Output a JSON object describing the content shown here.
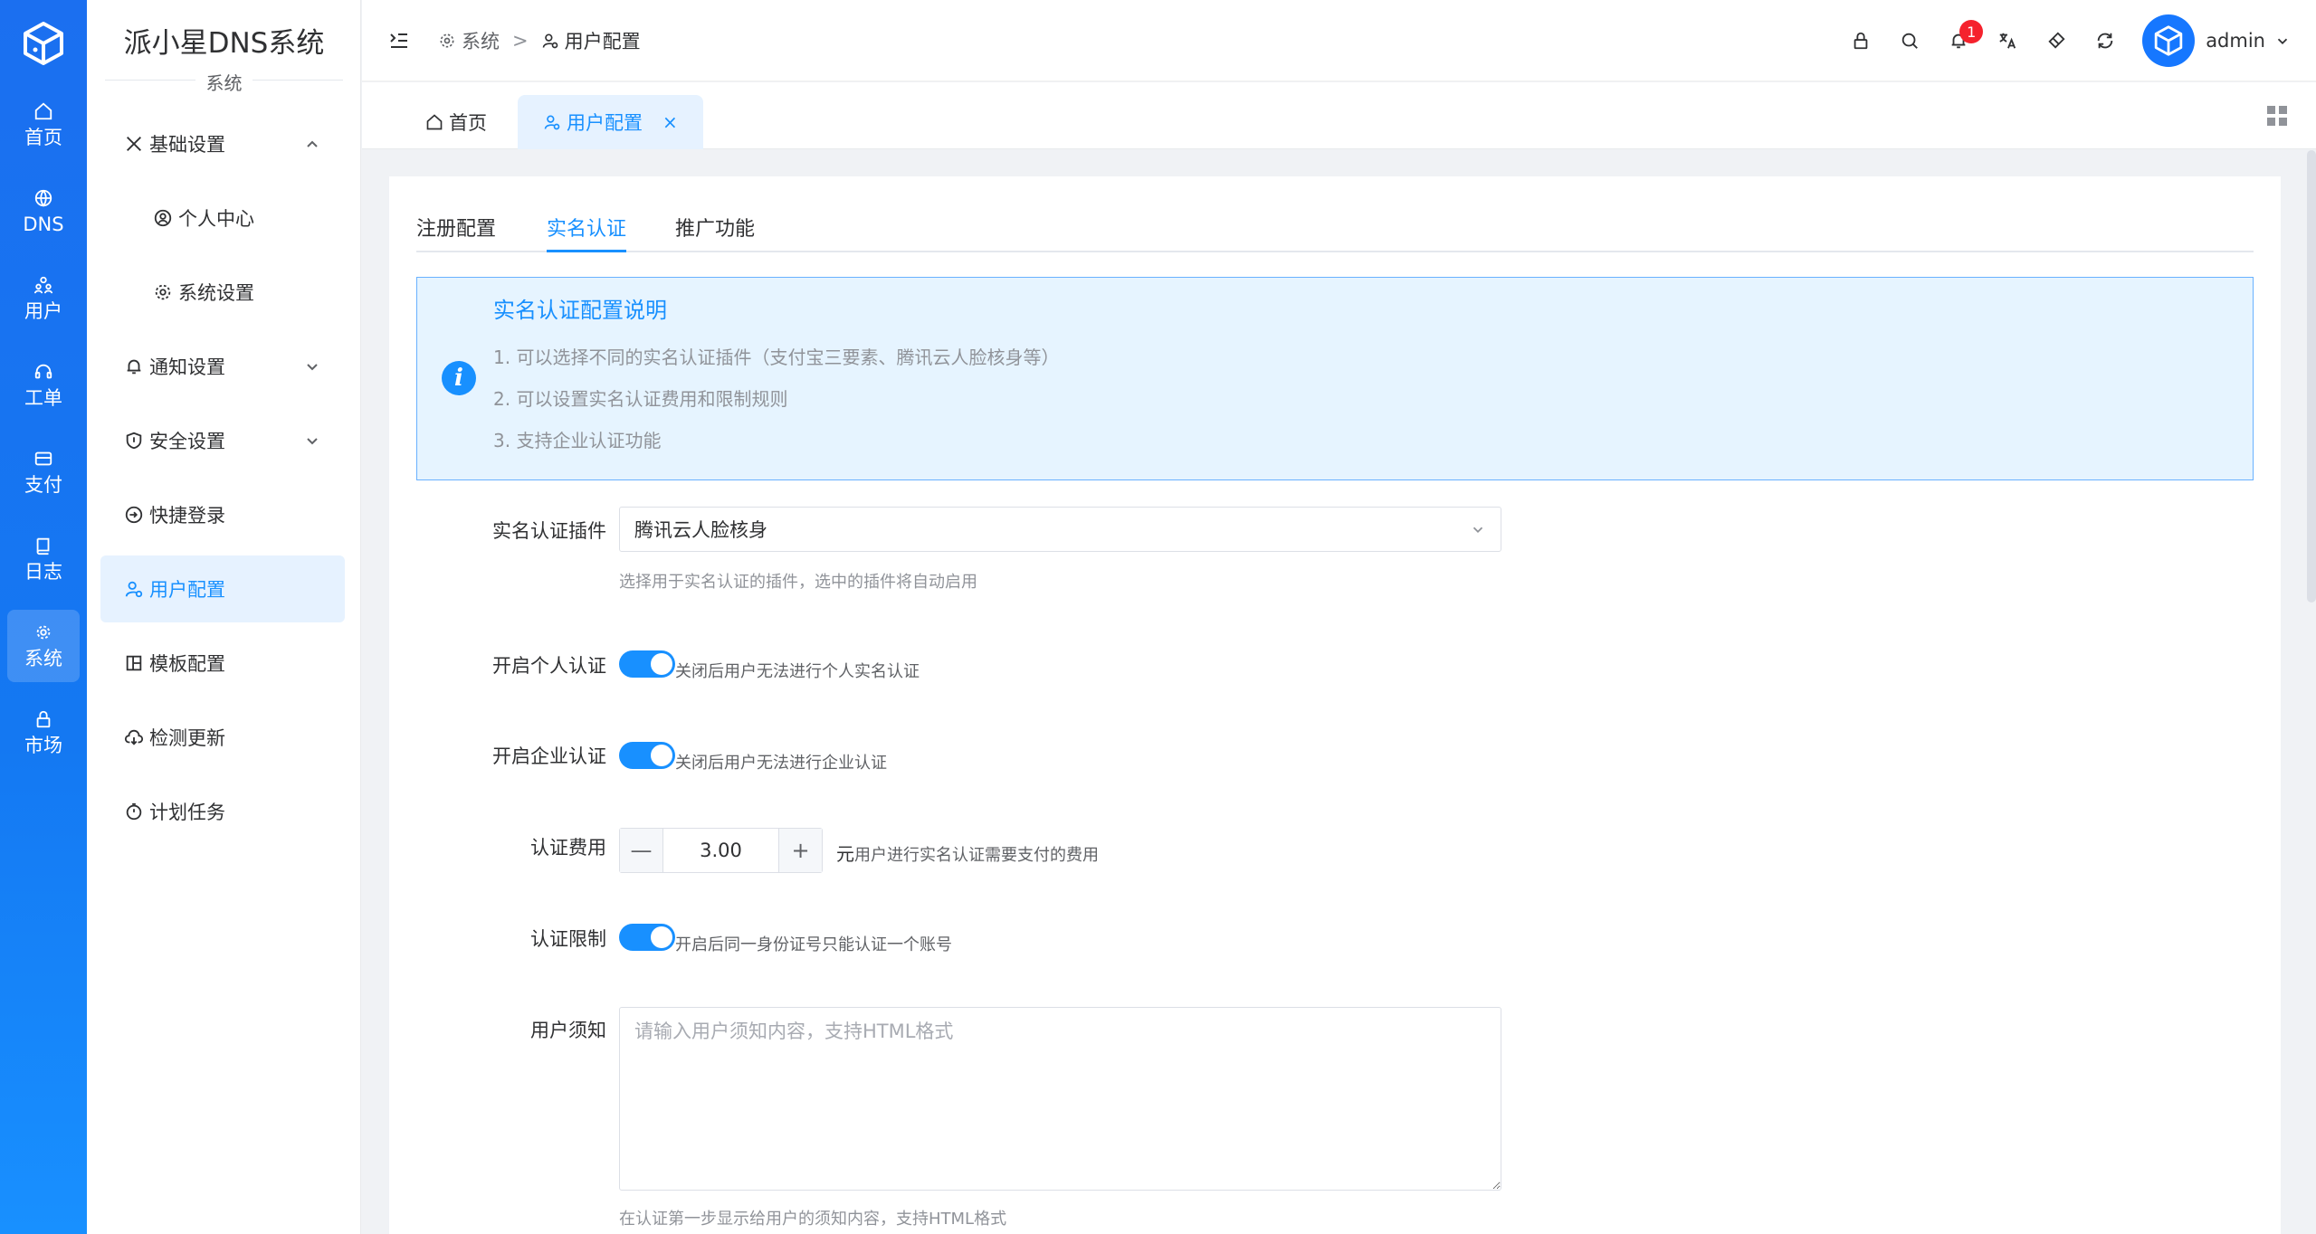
{
  "app": {
    "title": "派小星DNS系统",
    "section": "系统"
  },
  "rail": {
    "items": [
      {
        "label": "首页",
        "icon": "home-icon"
      },
      {
        "label": "DNS",
        "icon": "globe-icon"
      },
      {
        "label": "用户",
        "icon": "users-icon"
      },
      {
        "label": "工单",
        "icon": "headset-icon"
      },
      {
        "label": "支付",
        "icon": "wallet-icon"
      },
      {
        "label": "日志",
        "icon": "book-icon"
      },
      {
        "label": "系统",
        "icon": "gear-icon"
      },
      {
        "label": "市场",
        "icon": "lock-icon"
      }
    ],
    "active": "系统"
  },
  "sidebar": {
    "items": [
      {
        "label": "基础设置",
        "icon": "tools-icon"
      },
      {
        "label": "个人中心",
        "icon": "user-circle-icon"
      },
      {
        "label": "系统设置",
        "icon": "gear-icon"
      },
      {
        "label": "通知设置",
        "icon": "bell-icon"
      },
      {
        "label": "安全设置",
        "icon": "shield-icon"
      },
      {
        "label": "快捷登录",
        "icon": "login-icon"
      },
      {
        "label": "用户配置",
        "icon": "user-config-icon"
      },
      {
        "label": "模板配置",
        "icon": "layout-icon"
      },
      {
        "label": "检测更新",
        "icon": "cloud-download-icon"
      },
      {
        "label": "计划任务",
        "icon": "timer-icon"
      }
    ]
  },
  "header": {
    "breadcrumb": {
      "root": "系统",
      "separator": ">",
      "current": "用户配置"
    },
    "notification_count": "1",
    "username": "admin"
  },
  "tabs": [
    {
      "label": "首页"
    },
    {
      "label": "用户配置",
      "close": "×"
    }
  ],
  "subtabs": [
    "注册配置",
    "实名认证",
    "推广功能"
  ],
  "alert": {
    "title": "实名认证配置说明",
    "lines": [
      "1. 可以选择不同的实名认证插件（支付宝三要素、腾讯云人脸核身等）",
      "2. 可以设置实名认证费用和限制规则",
      "3. 支持企业认证功能"
    ]
  },
  "form": {
    "plugin": {
      "label": "实名认证插件",
      "value": "腾讯云人脸核身",
      "hint": "选择用于实名认证的插件，选中的插件将自动启用"
    },
    "personal": {
      "label": "开启个人认证",
      "enabled": true,
      "hint": "关闭后用户无法进行个人实名认证"
    },
    "enterprise": {
      "label": "开启企业认证",
      "enabled": true,
      "hint": "关闭后用户无法进行企业认证"
    },
    "fee": {
      "label": "认证费用",
      "value": "3.00",
      "unit": "元",
      "hint": "用户进行实名认证需要支付的费用",
      "minus": "—",
      "plus": "+"
    },
    "limit": {
      "label": "认证限制",
      "enabled": true,
      "hint": "开启后同一身份证号只能认证一个账号"
    },
    "notice": {
      "label": "用户须知",
      "placeholder": "请输入用户须知内容，支持HTML格式",
      "hint": "在认证第一步显示给用户的须知内容，支持HTML格式"
    }
  },
  "colors": {
    "primary": "#1890ff",
    "rail": "#1677ff",
    "alert_bg": "#e6f4ff",
    "badge": "#f5222d"
  }
}
